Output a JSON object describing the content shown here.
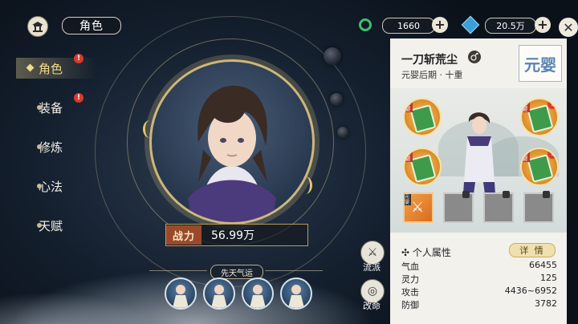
{
  "header": {
    "title": "角色",
    "resource_jade": "1660",
    "resource_stone": "20.5万"
  },
  "nav": {
    "items": [
      {
        "label": "角色",
        "active": true,
        "badge": "!"
      },
      {
        "label": "装备",
        "active": false,
        "badge": "!"
      },
      {
        "label": "修炼",
        "active": false,
        "badge": ""
      },
      {
        "label": "心法",
        "active": false,
        "badge": ""
      },
      {
        "label": "天赋",
        "active": false,
        "badge": ""
      }
    ]
  },
  "center": {
    "power_tag": "战力",
    "power_value": "56.99万",
    "fate_label": "先天气运"
  },
  "side": {
    "faction_label": "流派",
    "fate_change_label": "改命"
  },
  "panel": {
    "name": "一刀斩荒尘",
    "realm_sub": "元婴后期 · 十重",
    "realm_seal": "元婴",
    "gear_tag": "元婴",
    "slot_tag": "元婴",
    "attr_header": "个人属性",
    "detail_button": "详 情",
    "attributes": [
      {
        "label": "气血",
        "value": "66455"
      },
      {
        "label": "灵力",
        "value": "125"
      },
      {
        "label": "攻击",
        "value": "4436~6952"
      },
      {
        "label": "防御",
        "value": "3782"
      }
    ]
  },
  "colors": {
    "accent_gold": "#cdb77a",
    "badge_red": "#d83b2c",
    "active_nav": "#f0d98a"
  }
}
